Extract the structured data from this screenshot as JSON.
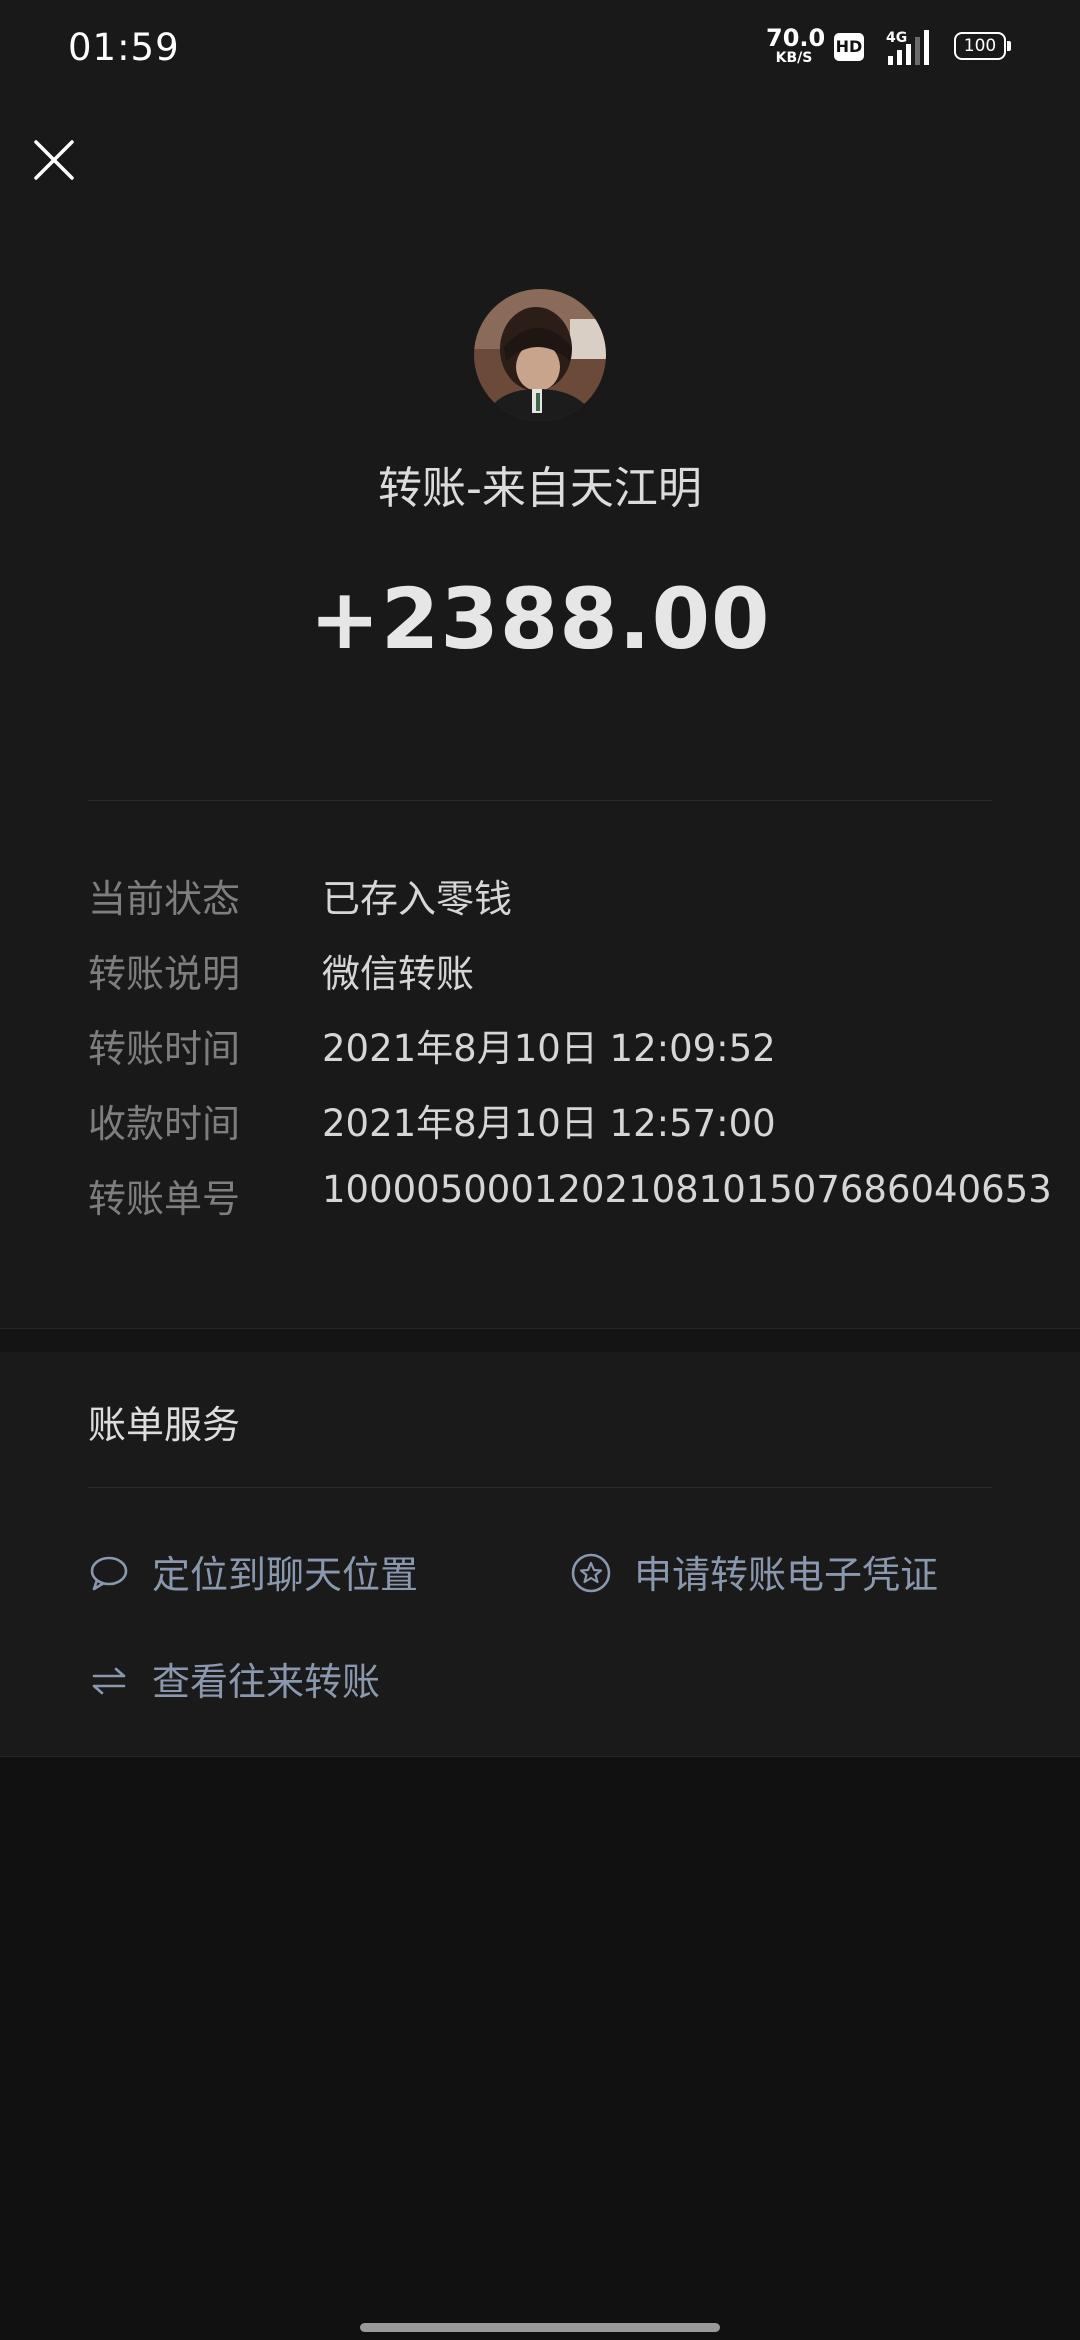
{
  "status_bar": {
    "time": "01:59",
    "net_speed_value": "70.0",
    "net_speed_unit": "KB/S",
    "hd_label": "HD",
    "network_type": "4G",
    "battery": "100"
  },
  "close_icon": "close-icon",
  "header": {
    "avatar_icon": "user-avatar",
    "title": "转账-来自天江明",
    "amount": "+2388.00"
  },
  "details": [
    {
      "label": "当前状态",
      "value": "已存入零钱"
    },
    {
      "label": "转账说明",
      "value": "微信转账"
    },
    {
      "label": "转账时间",
      "value": "2021年8月10日 12:09:52"
    },
    {
      "label": "收款时间",
      "value": "2021年8月10日 12:57:00"
    },
    {
      "label": "转账单号",
      "value": "1000050001202108101507686040653"
    }
  ],
  "services": {
    "title": "账单服务",
    "items": [
      {
        "label": "定位到聊天位置",
        "icon": "chat-bubble-icon"
      },
      {
        "label": "申请转账电子凭证",
        "icon": "star-badge-icon"
      },
      {
        "label": "查看往来转账",
        "icon": "transfer-arrows-icon"
      }
    ]
  },
  "colors": {
    "background": "#111111",
    "card": "#191919",
    "label_gray": "#7e7e7e",
    "link_blue_gray": "#8a98ae"
  }
}
